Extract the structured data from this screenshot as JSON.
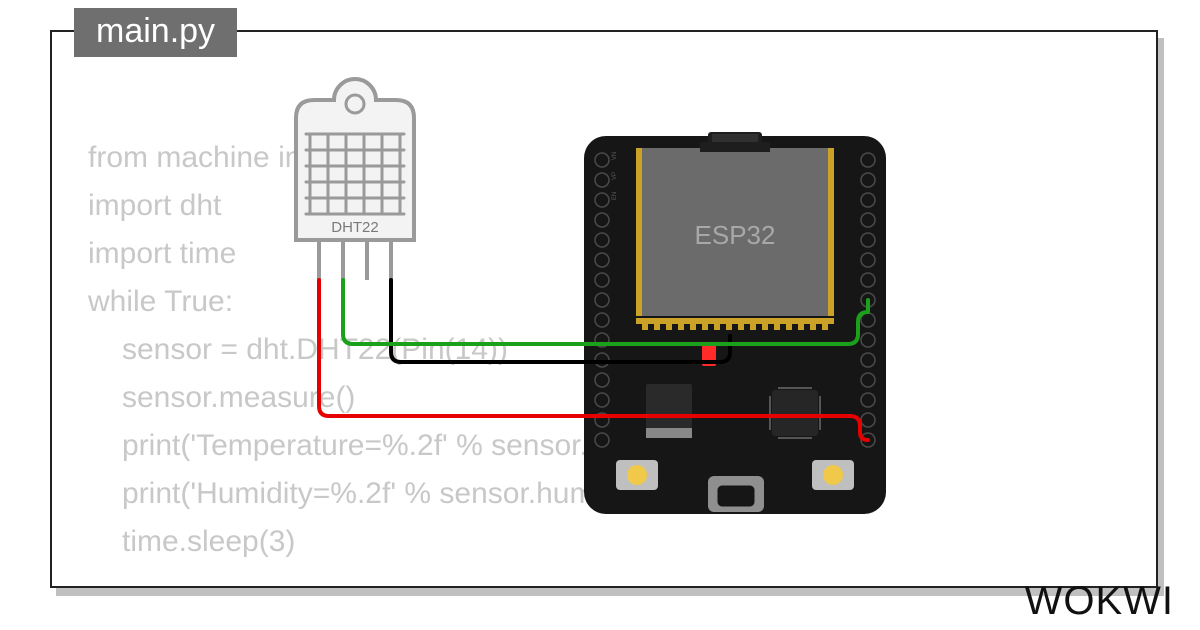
{
  "filename": "main.py",
  "code": {
    "l1": "from machine import Pin",
    "l2": "import dht",
    "l3": "import time",
    "l4": "while True:",
    "l5": "sensor = dht.DHT22(Pin(14))",
    "l6": "sensor.measure()",
    "l7": "print('Temperature=%.2f' % sensor.temperature())",
    "l8": "print('Humidity=%.2f' % sensor.humidity())",
    "l9": "time.sleep(3)"
  },
  "components": {
    "sensor_label": "DHT22",
    "board_label": "ESP32"
  },
  "wires": {
    "colors": {
      "vcc": "#e60000",
      "gnd": "#000000",
      "data": "#1aa01a"
    },
    "map": [
      {
        "sensor_pin": "VCC",
        "board_pin": "3V3",
        "color": "vcc"
      },
      {
        "sensor_pin": "SDA",
        "board_pin": "D14",
        "color": "data"
      },
      {
        "sensor_pin": "GND",
        "board_pin": "GND",
        "color": "gnd"
      }
    ]
  },
  "brand": "WOKWI"
}
